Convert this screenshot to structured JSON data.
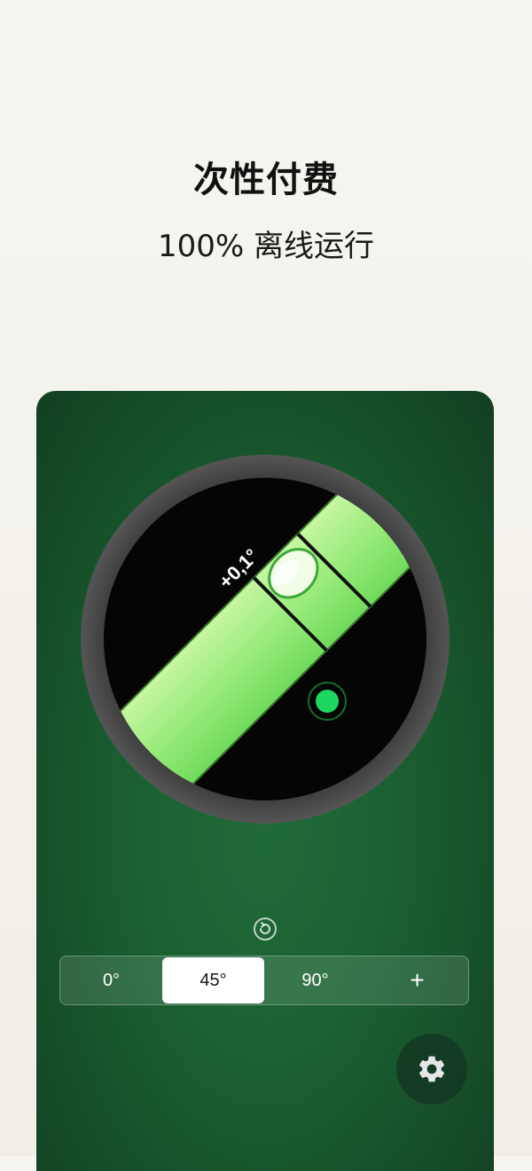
{
  "headline": "次性付费",
  "subline": "100% 离线运行",
  "level": {
    "angle_readout": "+0,1°",
    "vial_tilt_deg": -45
  },
  "angle_options": [
    {
      "label": "0°",
      "active": false
    },
    {
      "label": "45°",
      "active": true
    },
    {
      "label": "90°",
      "active": false
    },
    {
      "label": "+",
      "active": false
    }
  ],
  "icons": {
    "reset": "rotate-reset-icon",
    "settings": "gear-icon"
  },
  "colors": {
    "vial_green": "#8fe86f",
    "indicator_green": "#1ed760",
    "card_green": "#1c5f31",
    "bezel": "#4a4a4a"
  }
}
